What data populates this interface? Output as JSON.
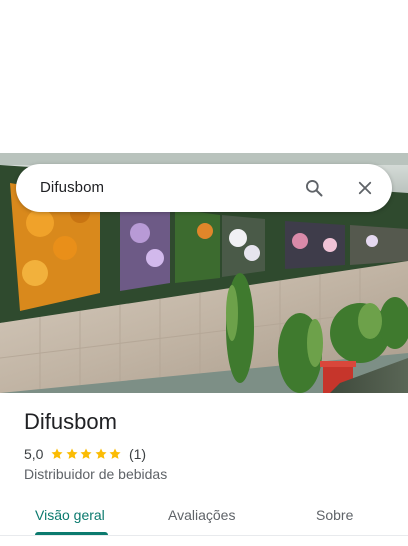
{
  "search": {
    "value": "Difusbom"
  },
  "place": {
    "name": "Difusbom",
    "rating": "5,0",
    "rating_value": 5,
    "review_count": "(1)",
    "category": "Distribuidor de bebidas"
  },
  "tabs": [
    {
      "label": "Visão geral",
      "active": true
    },
    {
      "label": "Avaliações",
      "active": false
    },
    {
      "label": "Sobre",
      "active": false
    }
  ],
  "icons": {
    "search": "search-icon",
    "close": "close-icon",
    "star": "star-icon"
  },
  "colors": {
    "accent": "#0b7a6e",
    "star": "#fbbc04",
    "text": "#202124",
    "secondary": "#5f6368"
  }
}
